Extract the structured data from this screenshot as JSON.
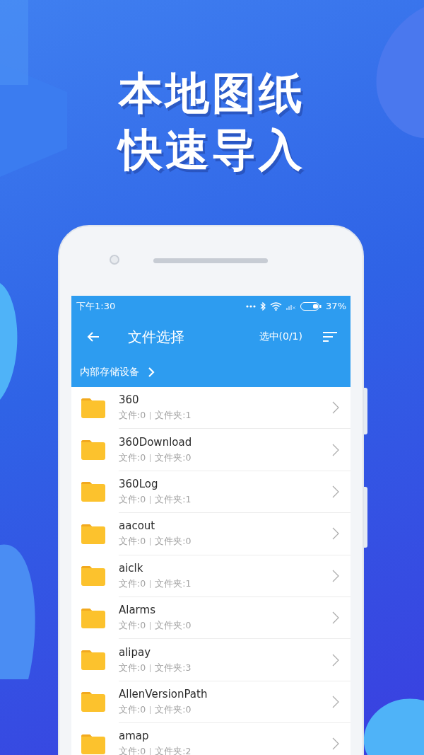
{
  "headline": [
    "本地图纸",
    "快速导入"
  ],
  "status_bar": {
    "time": "下午1:30",
    "battery": "37%"
  },
  "toolbar": {
    "title": "文件选择",
    "selection": "选中(0/1)"
  },
  "breadcrumb": {
    "label": "内部存储设备"
  },
  "folders": [
    {
      "name": "360",
      "files": "文件:0",
      "subfolders": "文件夹:1"
    },
    {
      "name": "360Download",
      "files": "文件:0",
      "subfolders": "文件夹:0"
    },
    {
      "name": "360Log",
      "files": "文件:0",
      "subfolders": "文件夹:1"
    },
    {
      "name": "aacout",
      "files": "文件:0",
      "subfolders": "文件夹:0"
    },
    {
      "name": "aiclk",
      "files": "文件:0",
      "subfolders": "文件夹:1"
    },
    {
      "name": "Alarms",
      "files": "文件:0",
      "subfolders": "文件夹:0"
    },
    {
      "name": "alipay",
      "files": "文件:0",
      "subfolders": "文件夹:3"
    },
    {
      "name": "AllenVersionPath",
      "files": "文件:0",
      "subfolders": "文件夹:0"
    },
    {
      "name": "amap",
      "files": "文件:0",
      "subfolders": "文件夹:2"
    }
  ]
}
